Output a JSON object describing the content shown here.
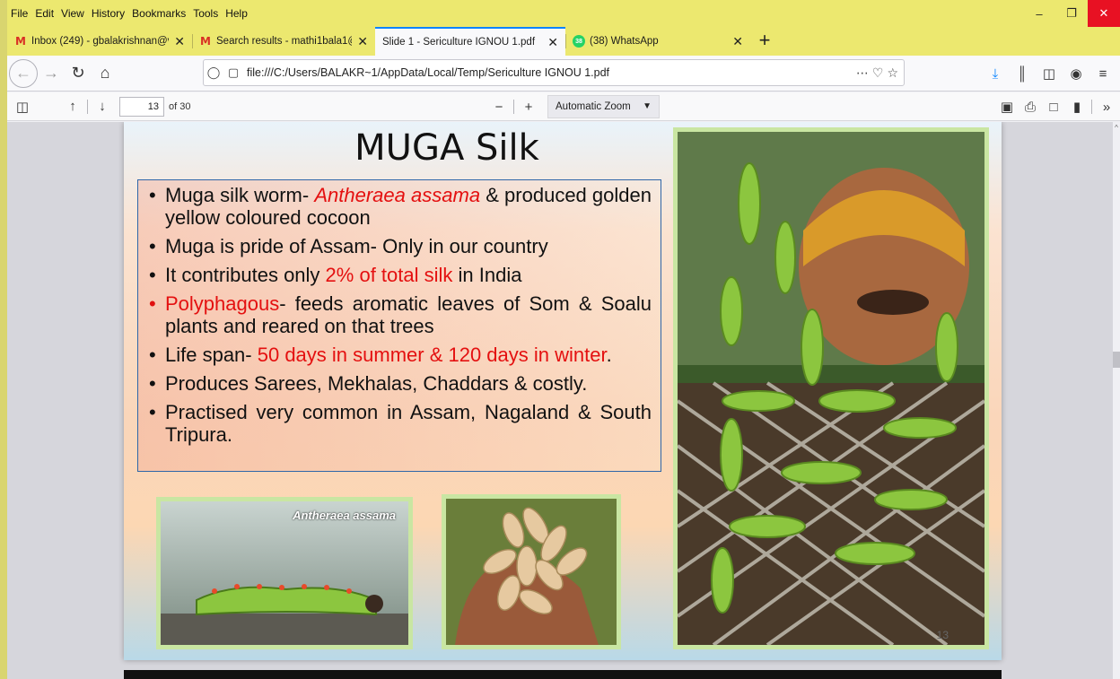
{
  "menubar": {
    "items": [
      "File",
      "Edit",
      "View",
      "History",
      "Bookmarks",
      "Tools",
      "Help"
    ]
  },
  "tabs": [
    {
      "label": "Inbox (249) - gbalakrishnan@vi",
      "icon": "gmail-icon"
    },
    {
      "label": "Search results - mathi1bala1@g",
      "icon": "gmail-icon"
    },
    {
      "label": "Slide 1 - Sericulture IGNOU 1.pdf",
      "icon": "none",
      "active": true
    },
    {
      "label": "(38) WhatsApp",
      "icon": "whatsapp-icon"
    }
  ],
  "whatsapp_badge": "38",
  "navbar": {
    "url": "file:///C:/Users/BALAKR~1/AppData/Local/Temp/Sericulture IGNOU 1.pdf"
  },
  "pdf_toolbar": {
    "page_number": "13",
    "page_count": "of 30",
    "zoom": "Automatic Zoom"
  },
  "slide": {
    "title": "MUGA Silk",
    "bullets": {
      "b1_pre": "Muga silk worm- ",
      "b1_red": "Antheraea assama",
      "b1_post": " & produced golden yellow coloured cocoon",
      "b2": "Muga is pride of Assam- Only in our country",
      "b3_pre": "It contributes only ",
      "b3_red": "2% of total silk",
      "b3_post": " in India",
      "b4_red": "Polyphagous",
      "b4_post": "- feeds aromatic leaves of Som & Soalu plants and reared on  that trees",
      "b5_pre": "Life span- ",
      "b5_red": "50 days in summer & 120 days in winter",
      "b5_post": ".",
      "b6": "Produces Sarees, Mekhalas, Chaddars & costly.",
      "b7": "Practised very common in Assam, Nagaland & South Tripura."
    },
    "caterpillar_label": "Antheraea assama",
    "slide_number": "13"
  },
  "colors": {
    "accent_red": "#e41010",
    "box_border": "#2f66a8",
    "menubar_bg": "#ece86f",
    "active_tab_line": "#0a84ff"
  }
}
